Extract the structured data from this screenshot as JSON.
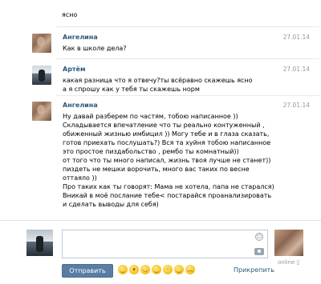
{
  "history": {
    "top_text": "ясно",
    "messages": [
      {
        "author": "Ангелина",
        "date": "27.01.14",
        "text": "Как в школе дела?",
        "avatar_icon": "user-avatar-angelina"
      },
      {
        "author": "Артём",
        "date": "27.01.14",
        "text": "какая разница что я отвечу?ты всёравно скажешь ясно\nа я спрошу как у тебя ты скажешь норм",
        "avatar_icon": "user-avatar-artem"
      },
      {
        "author": "Ангелина",
        "date": "27.01.14",
        "text": "Ну давай разберем по частям, тобою написанное ))\nСкладывается впечатление что ты реально контуженный ,\nобиженный жизнью имбицил )) Могу тебе и в глаза сказать,\nготов приехать послушать?) Вся та хуйня тобою написанное\nэто простое пиздабольство , рембо ты комнатный))\n от того что ты много написал, жизнь твоя лучше не станет))\nпиздеть не мешки ворочить, много вас таких по весне\nоттаяло ))\nПро таких как ты говорят: Мама не хотела, папа не старался)\nВникай в моё послание тебе< постарайся проанализировать\nи сделать выводы для себя)",
        "avatar_icon": "user-avatar-angelina"
      }
    ]
  },
  "composer": {
    "send_label": "Отправить",
    "pin_label": "Прикрепить",
    "status": "online",
    "emoji_icons": [
      "smile-emoji",
      "grin-emoji",
      "laugh-emoji",
      "wink-emoji",
      "tongue-emoji",
      "cool-emoji",
      "sad-emoji"
    ]
  }
}
